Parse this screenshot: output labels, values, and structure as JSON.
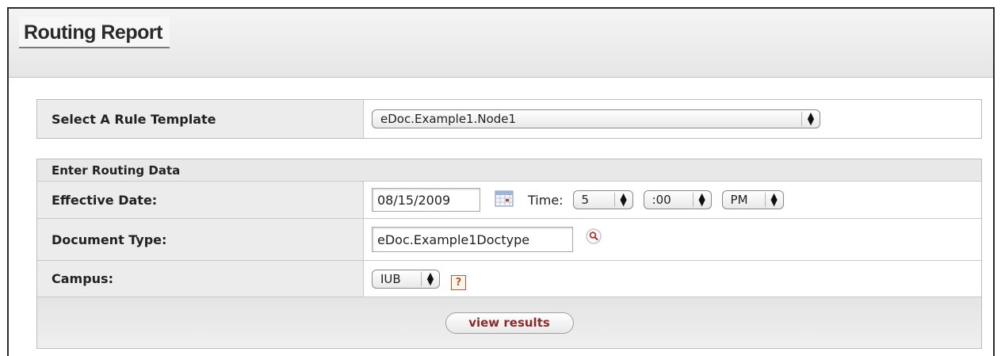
{
  "header": {
    "title": "Routing Report"
  },
  "rule_template": {
    "label": "Select A Rule Template",
    "selected": "eDoc.Example1.Node1"
  },
  "routing": {
    "section_title": "Enter Routing Data",
    "effective_date": {
      "label": "Effective Date:",
      "value": "08/15/2009",
      "time_label": "Time:",
      "hour": "5",
      "minute": ":00",
      "ampm": "PM"
    },
    "document_type": {
      "label": "Document Type:",
      "value": "eDoc.Example1Doctype"
    },
    "campus": {
      "label": "Campus:",
      "selected": "IUB",
      "help_glyph": "?"
    },
    "view_results_label": "view results"
  },
  "icons": {
    "calendar": "calendar-icon",
    "lookup": "magnifier-icon",
    "help": "help-icon",
    "select_arrows": "up-down-arrows-icon"
  },
  "colors": {
    "button_text": "#8a2a2a",
    "help_icon": "#b45a3c"
  }
}
